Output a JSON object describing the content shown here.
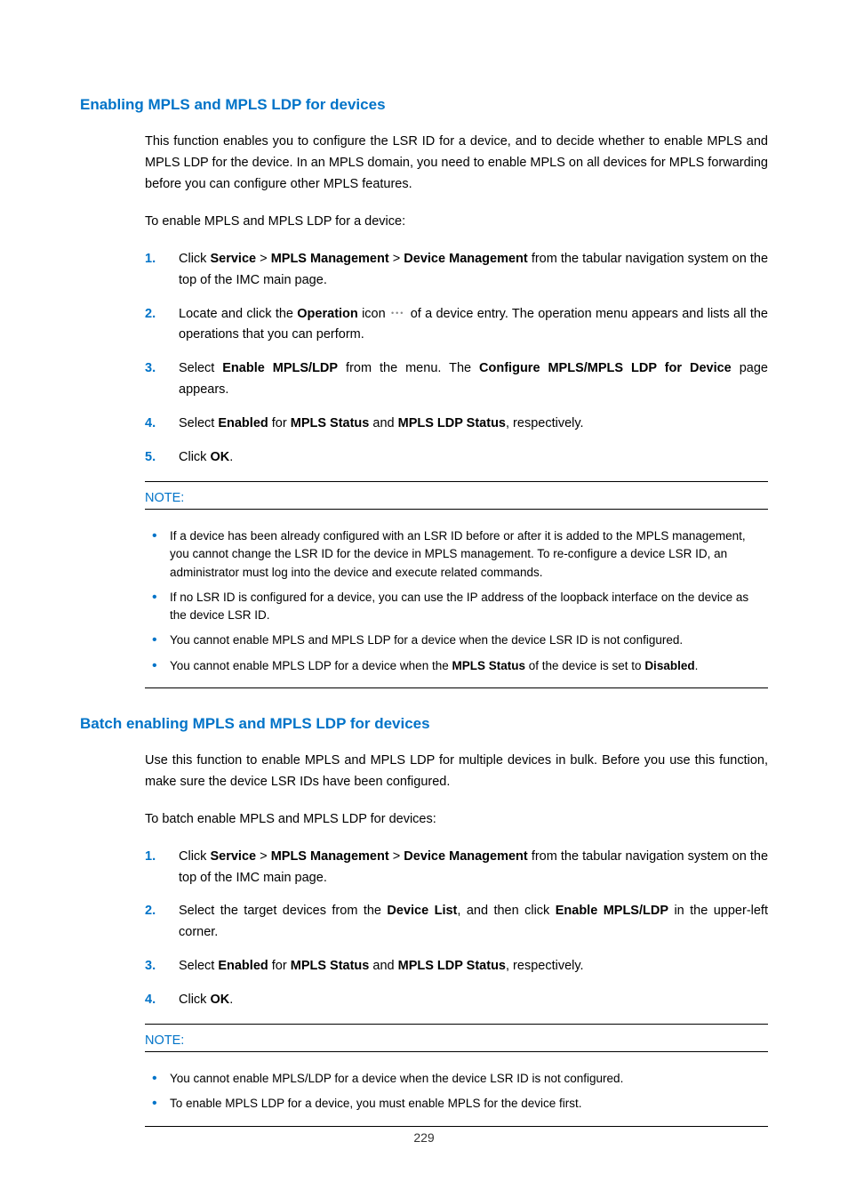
{
  "page_number": "229",
  "section1": {
    "heading": "Enabling MPLS and MPLS LDP for devices",
    "p1": "This function enables you to configure the LSR ID for a device, and to decide whether to enable MPLS and MPLS LDP for the device. In an MPLS domain, you need to enable MPLS on all devices for MPLS forwarding before you can configure other MPLS features.",
    "p2": "To enable MPLS and MPLS LDP for a device:",
    "steps": {
      "s1_a": "Click ",
      "s1_b": "Service",
      "s1_c": " > ",
      "s1_d": "MPLS Management",
      "s1_e": " > ",
      "s1_f": "Device Management",
      "s1_g": " from the tabular navigation system on the top of the IMC main page.",
      "s2_a": "Locate and click the ",
      "s2_b": "Operation",
      "s2_c": " icon ",
      "s2_d": " of a device entry. The operation menu appears and lists all the operations that you can perform.",
      "s3_a": "Select ",
      "s3_b": "Enable MPLS/LDP",
      "s3_c": " from the menu. The ",
      "s3_d": "Configure MPLS/MPLS LDP for Device",
      "s3_e": " page appears.",
      "s4_a": "Select ",
      "s4_b": "Enabled",
      "s4_c": " for ",
      "s4_d": "MPLS Status",
      "s4_e": " and ",
      "s4_f": "MPLS LDP Status",
      "s4_g": ", respectively.",
      "s5_a": "Click ",
      "s5_b": "OK",
      "s5_c": "."
    },
    "note_label": "NOTE:",
    "notes": {
      "n1": "If a device has been already configured with an LSR ID before or after it is added to the MPLS management, you cannot change the LSR ID for the device in MPLS management. To re-configure a device LSR ID, an administrator must log into the device and execute related commands.",
      "n2": "If no LSR ID is configured for a device, you can use the IP address of the loopback interface on the device as the device LSR ID.",
      "n3": "You cannot enable MPLS and MPLS LDP for a device when the device LSR ID is not configured.",
      "n4_a": "You cannot enable MPLS LDP for a device when the ",
      "n4_b": "MPLS Status",
      "n4_c": " of the device is set to ",
      "n4_d": "Disabled",
      "n4_e": "."
    }
  },
  "section2": {
    "heading": "Batch enabling MPLS and MPLS LDP for devices",
    "p1": "Use this function to enable MPLS and MPLS LDP for multiple devices in bulk. Before you use this function, make sure the device LSR IDs have been configured.",
    "p2": "To batch enable MPLS and MPLS LDP for devices:",
    "steps": {
      "s1_a": "Click ",
      "s1_b": "Service",
      "s1_c": " > ",
      "s1_d": "MPLS Management",
      "s1_e": " > ",
      "s1_f": "Device Management",
      "s1_g": " from the tabular navigation system on the top of the IMC main page.",
      "s2_a": "Select the target devices from the ",
      "s2_b": "Device List",
      "s2_c": ", and then click ",
      "s2_d": "Enable MPLS/LDP",
      "s2_e": " in the upper-left corner.",
      "s3_a": "Select ",
      "s3_b": "Enabled",
      "s3_c": " for ",
      "s3_d": "MPLS Status",
      "s3_e": " and ",
      "s3_f": "MPLS LDP Status",
      "s3_g": ", respectively.",
      "s4_a": "Click ",
      "s4_b": "OK",
      "s4_c": "."
    },
    "note_label": "NOTE:",
    "notes": {
      "n1": "You cannot enable MPLS/LDP for a device when the device LSR ID is not configured.",
      "n2": "To enable MPLS LDP for a device, you must enable MPLS for the device first."
    }
  }
}
